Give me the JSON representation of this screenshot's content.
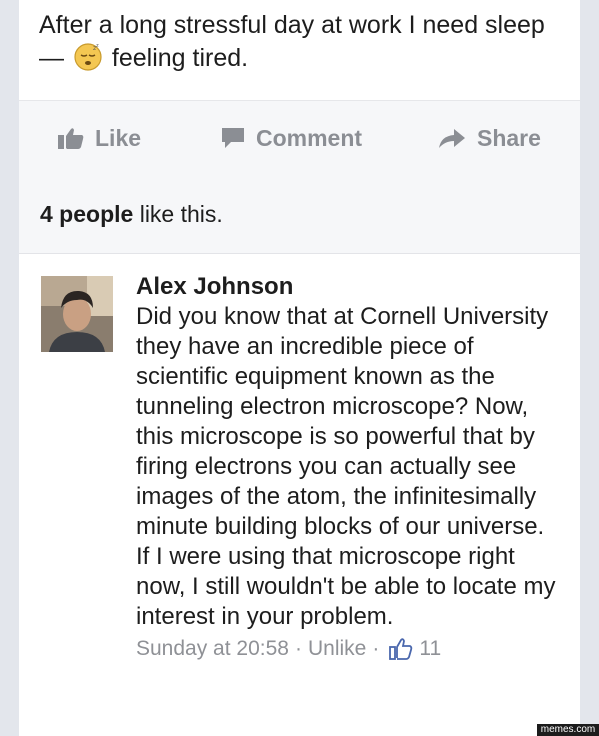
{
  "post": {
    "status_before": "After a long stressful day at work I need sleep —",
    "emoji_icon": "sleepy-face-icon",
    "status_after": "feeling tired."
  },
  "actions": {
    "like_label": "Like",
    "comment_label": "Comment",
    "share_label": "Share"
  },
  "likes": {
    "count_text": "4 people",
    "suffix": "like this."
  },
  "comment": {
    "author": "Alex Johnson",
    "text": "Did you know that at Cornell University they have an incredible piece of scientific equipment known as the tunneling electron microscope? Now, this microscope is so powerful that by firing electrons you can actually see images of the atom, the infinitesimally minute building blocks of our universe. If I were using that microscope right now, I still wouldn't be able to locate my interest in your problem.",
    "timestamp": "Sunday at 20:58",
    "separator": "·",
    "unlike_label": "Unlike",
    "like_count": "11"
  },
  "watermark": "memes.com",
  "colors": {
    "background": "#e3e6ec",
    "card": "#ffffff",
    "action_text": "#8b8e94",
    "meta_text": "#8f9196",
    "like_icon_blue": "#4a67ad"
  }
}
